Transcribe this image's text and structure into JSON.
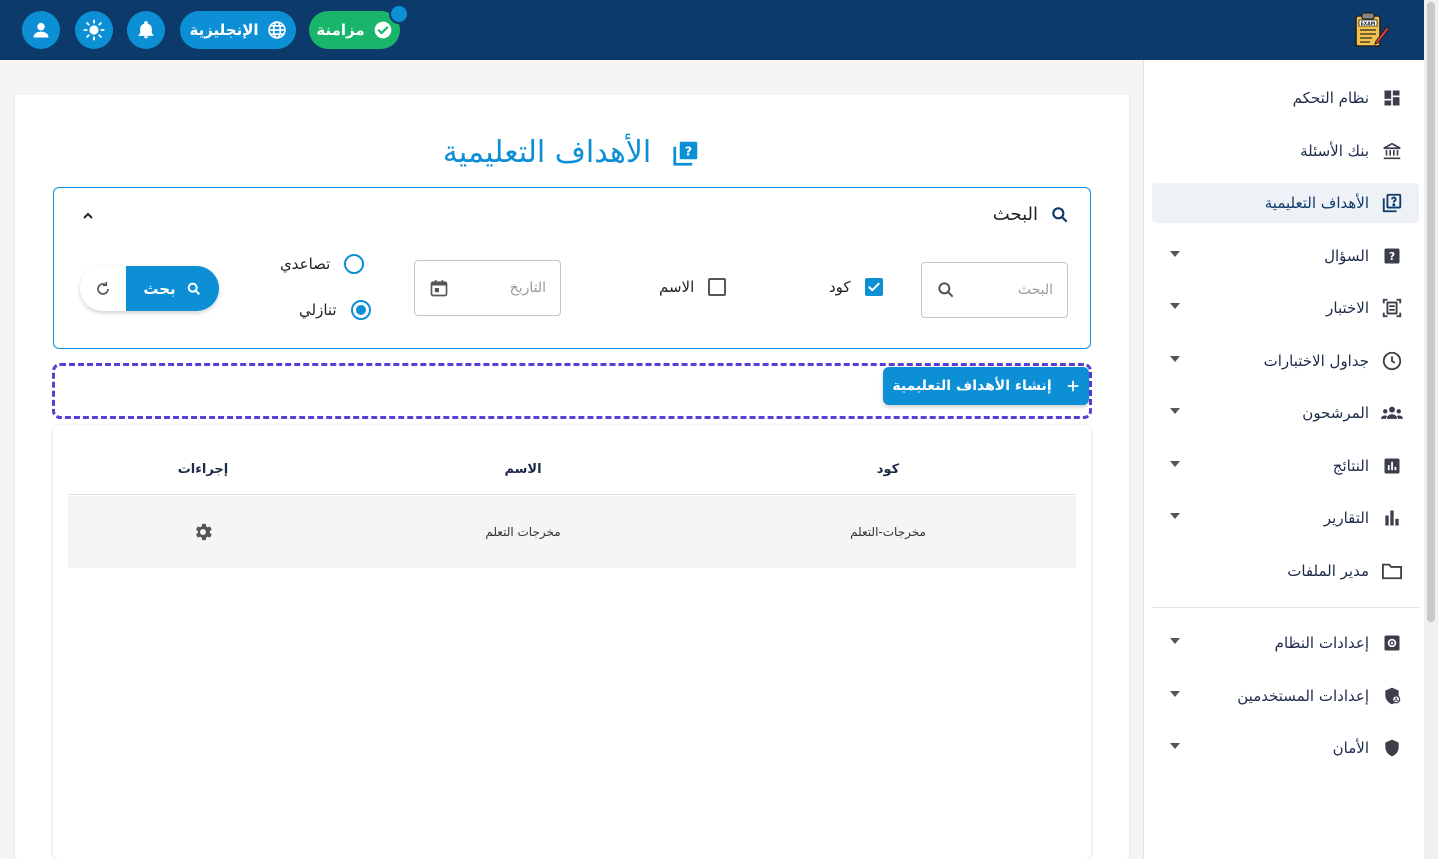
{
  "header": {
    "sync_label": "مزامنة",
    "language_label": "الإنجليزية",
    "logo_text": "EXAM"
  },
  "sidebar": {
    "items": [
      {
        "label": "نظام التحكم",
        "icon": "dashboard-icon"
      },
      {
        "label": "بنك الأسئلة",
        "icon": "bank-icon"
      },
      {
        "label": "الأهداف التعليمية",
        "icon": "quiz-icon",
        "active": true
      },
      {
        "label": "السؤال",
        "icon": "help-icon",
        "expandable": true
      },
      {
        "label": "الاختبار",
        "icon": "document-scan-icon",
        "expandable": true
      },
      {
        "label": "جداول الاختبارات",
        "icon": "clock-icon",
        "expandable": true
      },
      {
        "label": "المرشحون",
        "icon": "people-icon",
        "expandable": true
      },
      {
        "label": "النتائج",
        "icon": "poll-icon",
        "expandable": true
      },
      {
        "label": "التقارير",
        "icon": "bar-chart-icon",
        "expandable": true
      },
      {
        "label": "مدير الملفات",
        "icon": "folder-icon"
      },
      {
        "label": "إعدادات النظام",
        "icon": "settings-box-icon",
        "expandable": true
      },
      {
        "label": "إعدادات المستخدمين",
        "icon": "shield-user-icon",
        "expandable": true
      },
      {
        "label": "الأمان",
        "icon": "shield-icon",
        "expandable": true
      }
    ]
  },
  "page": {
    "title": "الأهداف التعليمية"
  },
  "search": {
    "heading": "البحث",
    "input_placeholder": "البحث",
    "date_placeholder": "التاريخ",
    "filter_code_label": "كود",
    "filter_code_checked": true,
    "filter_name_label": "الاسم",
    "filter_name_checked": false,
    "sort_asc_label": "تصاعدي",
    "sort_desc_label": "تنازلي",
    "sort_selected": "desc",
    "search_button": "بحث"
  },
  "toolbar": {
    "create_button": "إنشاء الأهداف التعليمية"
  },
  "table": {
    "columns": [
      "كود",
      "الاسم",
      "إجراءات"
    ],
    "rows": [
      {
        "code": "مخرجات-التعلم",
        "name": "مخرجات التعلم"
      }
    ]
  },
  "colors": {
    "header_bg": "#0c3a6b",
    "accent": "#0d8fd6",
    "sync_green": "#19b56a",
    "dashed_border": "#5b3ed6"
  }
}
